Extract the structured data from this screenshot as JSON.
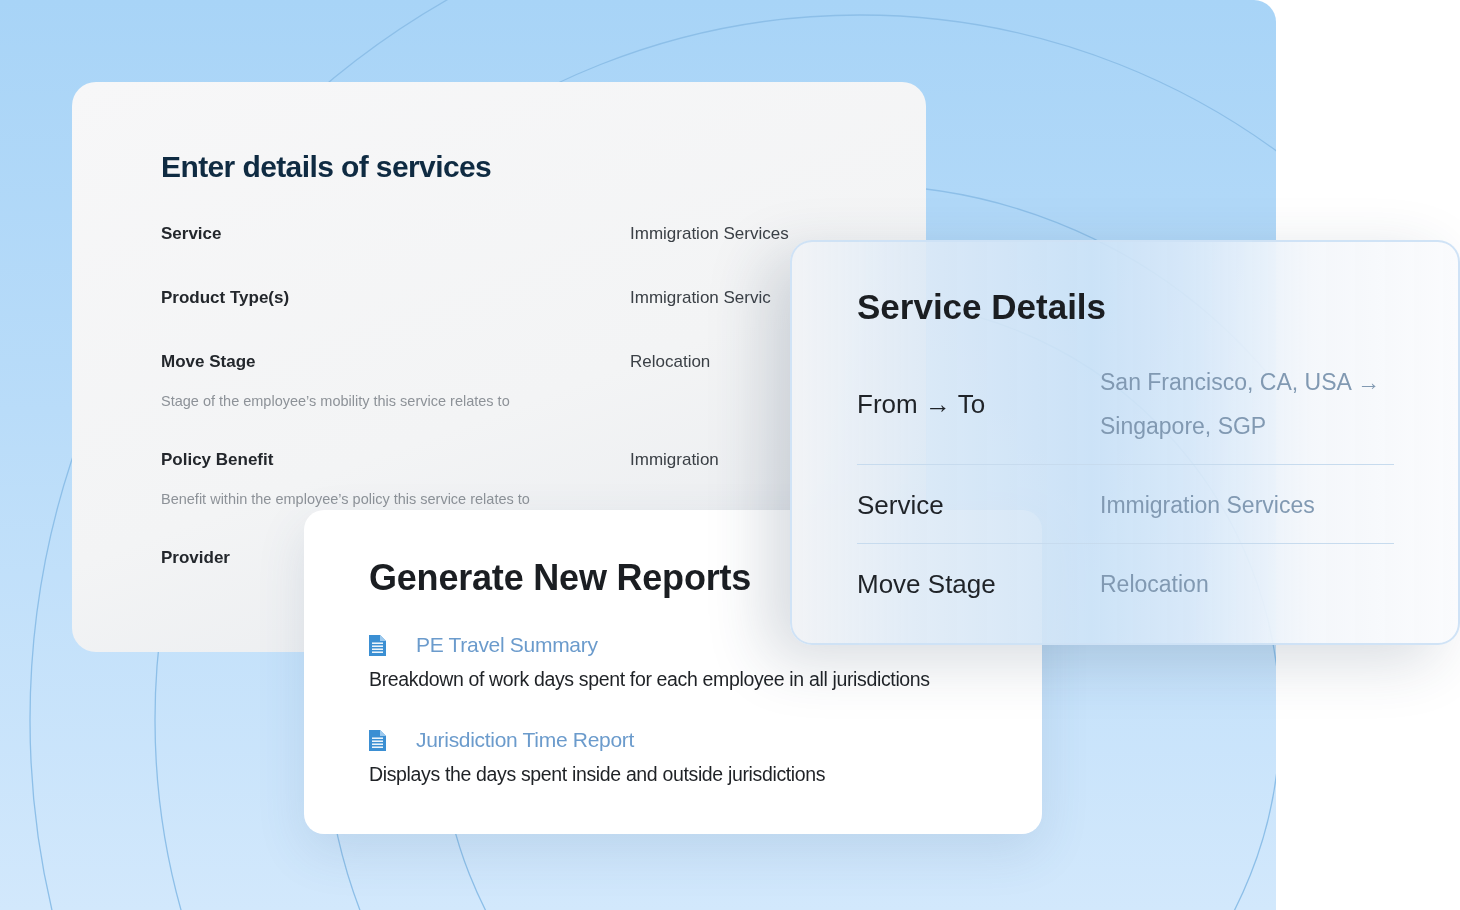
{
  "details_form": {
    "title": "Enter details of services",
    "fields": [
      {
        "label": "Service",
        "value": "Immigration Services"
      },
      {
        "label": "Product Type(s)",
        "value": "Immigration Servic"
      },
      {
        "label": "Move Stage",
        "value": "Relocation",
        "description": "Stage of the employee’s mobility this service relates to"
      },
      {
        "label": "Policy Benefit",
        "value": "Immigration",
        "description": "Benefit within the employee’s policy this service relates to"
      },
      {
        "label": "Provider"
      }
    ]
  },
  "reports_card": {
    "title": "Generate New Reports",
    "reports": [
      {
        "name": "PE Travel Summary",
        "description": "Breakdown of work days spent for each employee in all jurisdictions"
      },
      {
        "name": "Jurisdiction Time Report",
        "description": "Displays the days spent inside and outside jurisdictions"
      }
    ]
  },
  "service_details": {
    "title": "Service Details",
    "rows": [
      {
        "label": "From → To",
        "value": "San Francisco, CA, USA → Singapore, SGP"
      },
      {
        "label": "Service",
        "value": "Immigration Services"
      },
      {
        "label": "Move Stage",
        "value": "Relocation"
      }
    ]
  }
}
